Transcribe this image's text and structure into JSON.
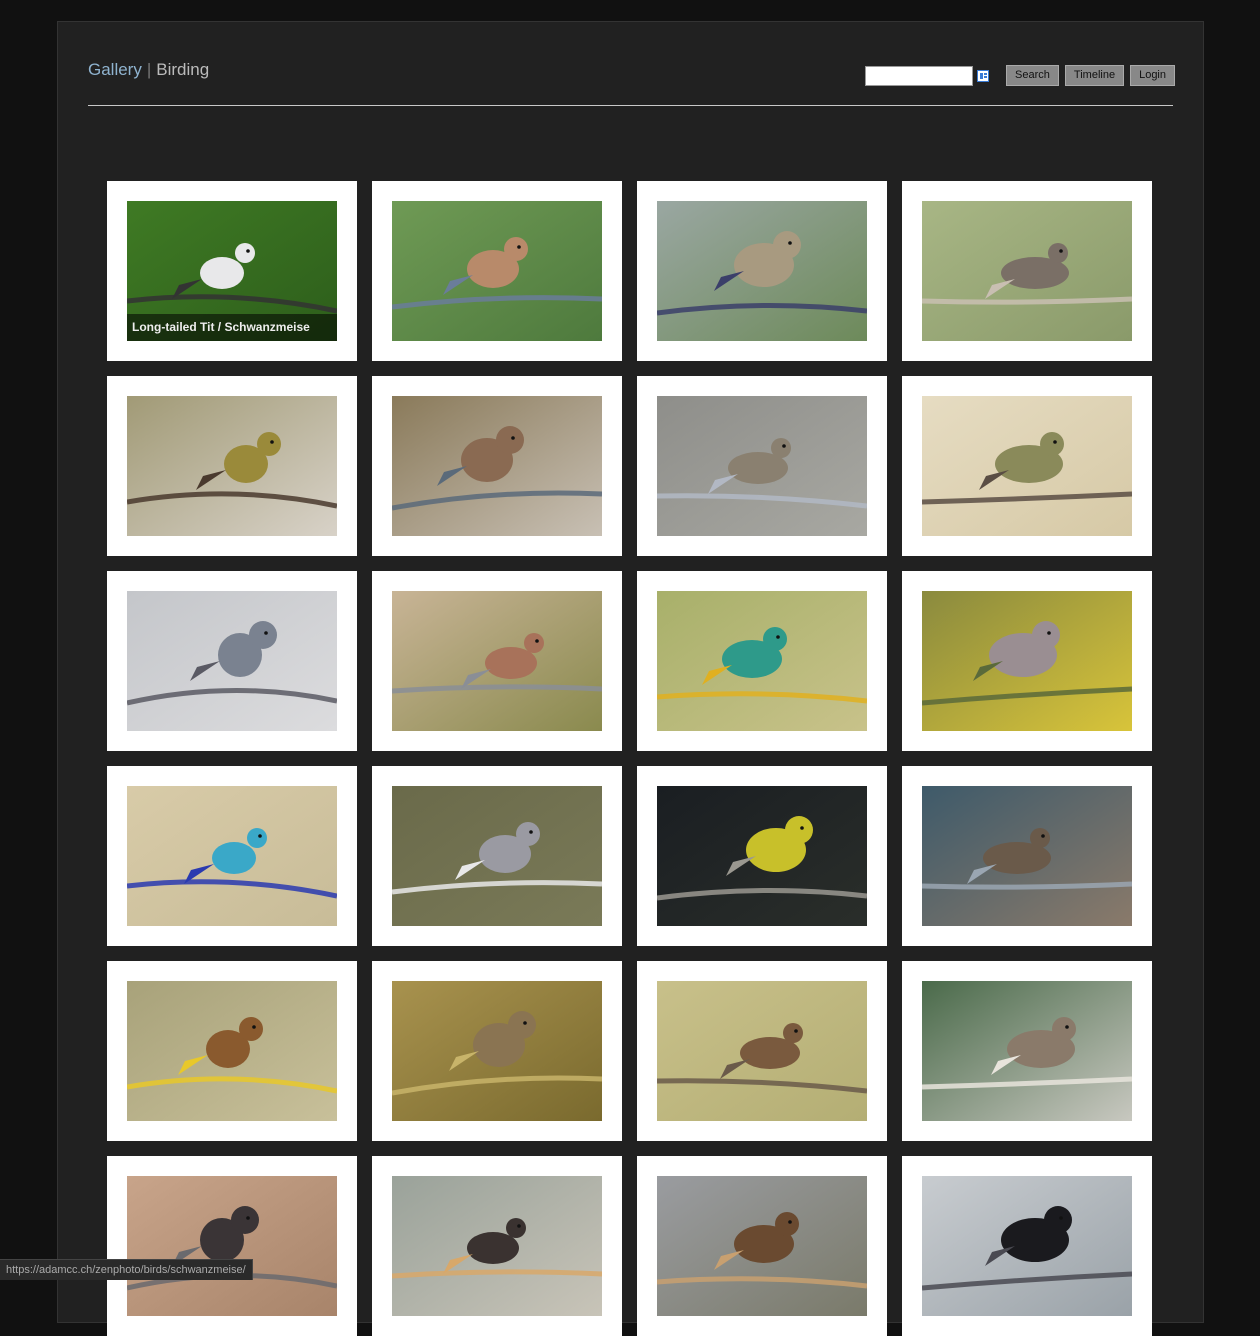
{
  "breadcrumb": {
    "gallery": "Gallery",
    "separator": "|",
    "album": "Birding"
  },
  "search": {
    "value": "",
    "placeholder": ""
  },
  "buttons": {
    "search": "Search",
    "timeline": "Timeline",
    "login": "Login"
  },
  "status_url": "https://adamcc.ch/zenphoto/birds/schwanzmeise/",
  "photos": [
    {
      "subject": "long-tailed-tit",
      "caption": "Long-tailed Tit / Schwanzmeise",
      "bg": [
        "#3f7a24",
        "#2d5e1b"
      ],
      "bird": "#e8e8ea",
      "accent": "#333333"
    },
    {
      "subject": "bird-on-mossy-branch",
      "caption": "",
      "bg": [
        "#6f9a55",
        "#4e7a3d"
      ],
      "bird": "#b88a6a",
      "accent": "#6a7d9a"
    },
    {
      "subject": "bird-in-plum-tree",
      "caption": "",
      "bg": [
        "#9aa7a2",
        "#6d8a5a"
      ],
      "bird": "#a89a80",
      "accent": "#3b3f6a"
    },
    {
      "subject": "bird-on-rock",
      "caption": "",
      "bg": [
        "#a8b685",
        "#8a9a6a"
      ],
      "bird": "#7a6f66",
      "accent": "#c9bfb2"
    },
    {
      "subject": "bunting-on-branch",
      "caption": "",
      "bg": [
        "#a19a76",
        "#d8d2c8"
      ],
      "bird": "#9a8a3a",
      "accent": "#4a3a2e"
    },
    {
      "subject": "nightingale",
      "caption": "",
      "bg": [
        "#8a7a5a",
        "#c8c0b4"
      ],
      "bird": "#8a6a52",
      "accent": "#5a6a7a"
    },
    {
      "subject": "sparrow-on-stick",
      "caption": "",
      "bg": [
        "#8e8e8a",
        "#a8a8a2"
      ],
      "bird": "#8a8070",
      "accent": "#b2b8c4"
    },
    {
      "subject": "warbler-on-twig",
      "caption": "",
      "bg": [
        "#e6dcc2",
        "#d6c9a6"
      ],
      "bird": "#8a8a5a",
      "accent": "#5a4e44"
    },
    {
      "subject": "flycatcher",
      "caption": "",
      "bg": [
        "#c4c6ca",
        "#dcdcde"
      ],
      "bird": "#7a8290",
      "accent": "#5a5a64"
    },
    {
      "subject": "turtle-dove",
      "caption": "",
      "bg": [
        "#c8b496",
        "#8a8a4e"
      ],
      "bird": "#a8725a",
      "accent": "#8a8e96"
    },
    {
      "subject": "bee-eaters",
      "caption": "",
      "bg": [
        "#a8b06a",
        "#c8c28a"
      ],
      "bird": "#2e9a8a",
      "accent": "#e0b020"
    },
    {
      "subject": "stock-dove",
      "caption": "",
      "bg": [
        "#8a8a3e",
        "#d8c43a"
      ],
      "bird": "#9a8e92",
      "accent": "#5a6a3a"
    },
    {
      "subject": "rollers",
      "caption": "",
      "bg": [
        "#d8cba8",
        "#c8bc98"
      ],
      "bird": "#3aa8c8",
      "accent": "#2a3ab0"
    },
    {
      "subject": "wood-pigeon",
      "caption": "",
      "bg": [
        "#6a6a4a",
        "#7a7a58"
      ],
      "bird": "#9a9aa2",
      "accent": "#e8e8e8"
    },
    {
      "subject": "greenfinch",
      "caption": "",
      "bg": [
        "#1a1e22",
        "#2a2e2a"
      ],
      "bird": "#c8c02a",
      "accent": "#9a9890"
    },
    {
      "subject": "owl-landing",
      "caption": "",
      "bg": [
        "#3e5a6a",
        "#8a7a6a"
      ],
      "bird": "#6a5a4a",
      "accent": "#9aa6b2"
    },
    {
      "subject": "kite-portrait",
      "caption": "",
      "bg": [
        "#a8a27a",
        "#c8c09a"
      ],
      "bird": "#8a5a2e",
      "accent": "#e8c82a"
    },
    {
      "subject": "crested-lark",
      "caption": "",
      "bg": [
        "#a8924e",
        "#7a6a2e"
      ],
      "bird": "#8a7452",
      "accent": "#c8b46a"
    },
    {
      "subject": "sparrow-flying",
      "caption": "",
      "bg": [
        "#c8c08a",
        "#b4ae74"
      ],
      "bird": "#7a5a3e",
      "accent": "#6a5a4a"
    },
    {
      "subject": "griffon-vultures",
      "caption": "",
      "bg": [
        "#4a6a4a",
        "#c8c8c0"
      ],
      "bird": "#8a7a6a",
      "accent": "#e8e4dc"
    },
    {
      "subject": "black-vulture",
      "caption": "",
      "bg": [
        "#c8a48a",
        "#a8846a"
      ],
      "bird": "#3a3436",
      "accent": "#6a6a6e"
    },
    {
      "subject": "eagle-in-flight",
      "caption": "",
      "bg": [
        "#9aa29a",
        "#c8c4b8"
      ],
      "bird": "#3a3230",
      "accent": "#d8a86a"
    },
    {
      "subject": "golden-eagle",
      "caption": "",
      "bg": [
        "#9a9ca0",
        "#7a7a6a"
      ],
      "bird": "#6a4a30",
      "accent": "#c8a070"
    },
    {
      "subject": "raven",
      "caption": "",
      "bg": [
        "#c8ccd0",
        "#9aa2a8"
      ],
      "bird": "#1a1a1e",
      "accent": "#4a4a52"
    }
  ]
}
